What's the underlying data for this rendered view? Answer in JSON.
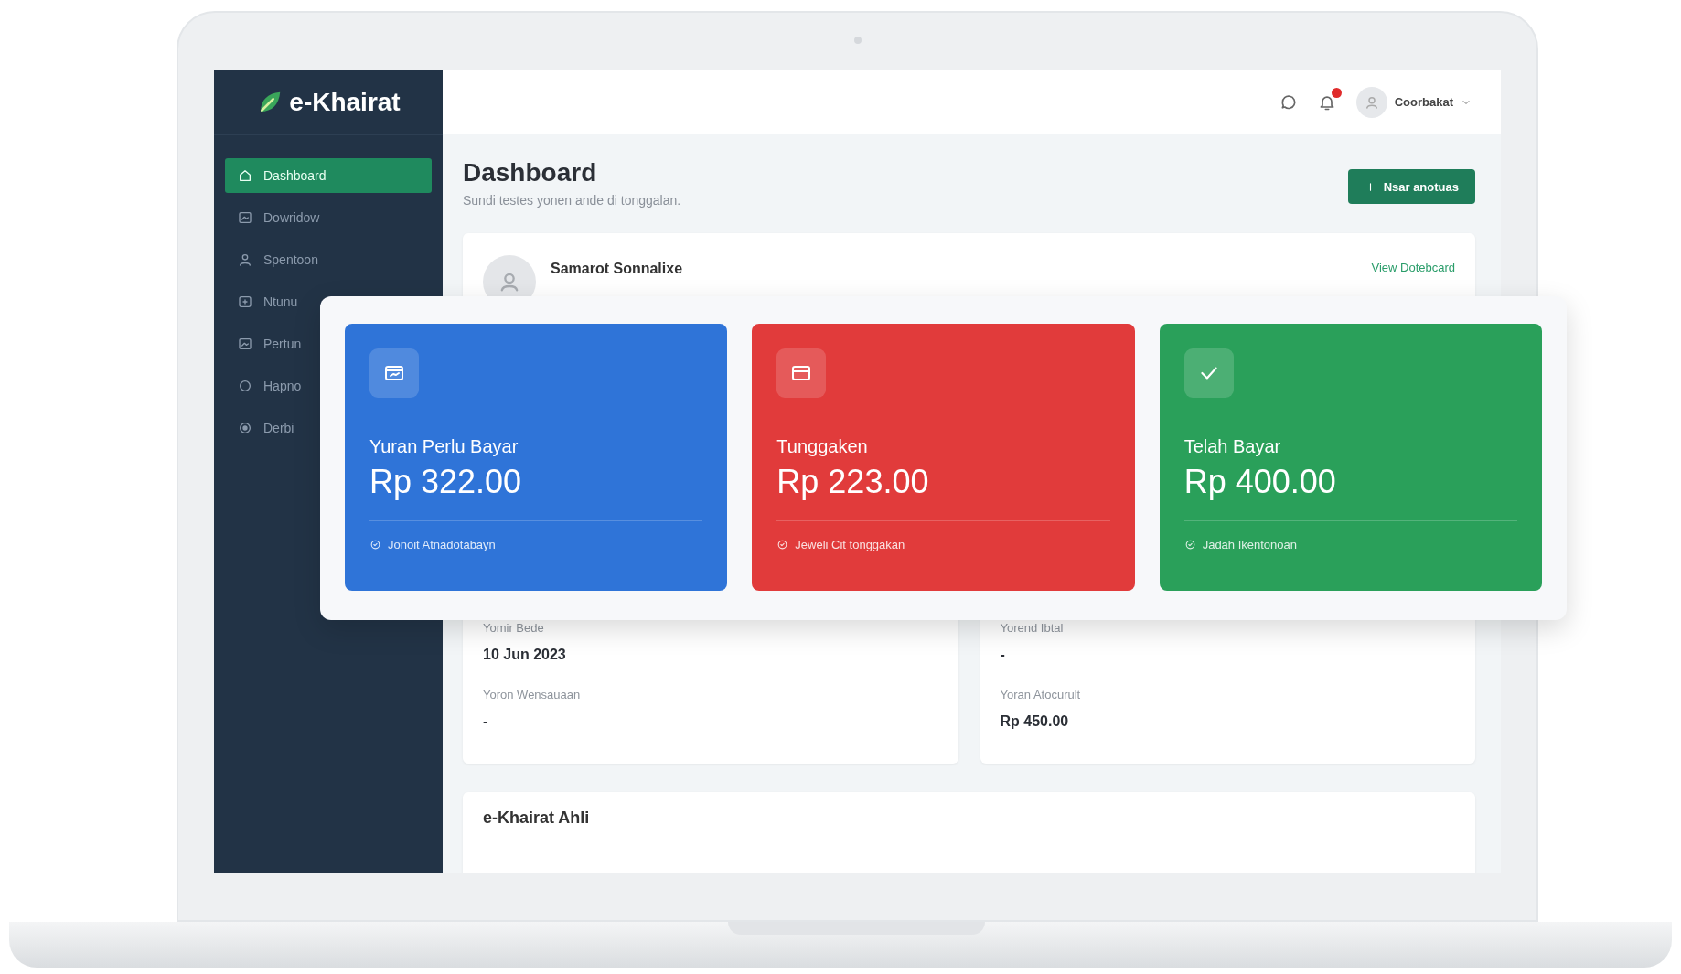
{
  "brand": "e-Khairat",
  "sidebar": {
    "items": [
      {
        "label": "Dashboard",
        "kind": "home",
        "selected": true
      },
      {
        "label": "Dowridow",
        "kind": "picture",
        "selected": false
      },
      {
        "label": "Spentoon",
        "kind": "user",
        "selected": false
      },
      {
        "label": "Ntunu",
        "kind": "plusbox",
        "selected": false
      },
      {
        "label": "Pertun",
        "kind": "picture",
        "selected": false
      },
      {
        "label": "Hapno",
        "kind": "ring",
        "selected": false
      },
      {
        "label": "Derbi",
        "kind": "dot",
        "selected": false
      }
    ]
  },
  "topbar": {
    "user_name": "Coorbakat"
  },
  "page": {
    "title": "Dashboard",
    "subtitle": "Sundi testes yonen ande di tonggalan.",
    "action_button": "Nsar anotuas"
  },
  "member": {
    "name": "Samarot Sonnalixe",
    "link": "View Dotebcard"
  },
  "stats": [
    {
      "kind": "wallet",
      "color": "#2f74d8",
      "title": "Yuran Perlu Bayar",
      "amount": "Rp 322.00",
      "footer": "Jonoit Atnadotabayn"
    },
    {
      "kind": "card",
      "color": "#e13b3b",
      "title": "Tunggaken",
      "amount": "Rp 223.00",
      "footer": "Jeweli Cit tonggakan"
    },
    {
      "kind": "check",
      "color": "#2aa05a",
      "title": "Telah Bayar",
      "amount": "Rp 400.00",
      "footer": "Jadah Ikentonoan"
    }
  ],
  "info_cards": [
    {
      "fields": [
        {
          "label": "Yomir Bede",
          "value": "10 Jun 2023"
        },
        {
          "label": "Yoron Wensauaan",
          "value": "-"
        }
      ]
    },
    {
      "fields": [
        {
          "label": "Yorend Ibtal",
          "value": "-"
        },
        {
          "label": "Yoran Atocurult",
          "value": "Rp 450.00"
        }
      ]
    }
  ],
  "section": {
    "title": "e-Khairat Ahli"
  }
}
